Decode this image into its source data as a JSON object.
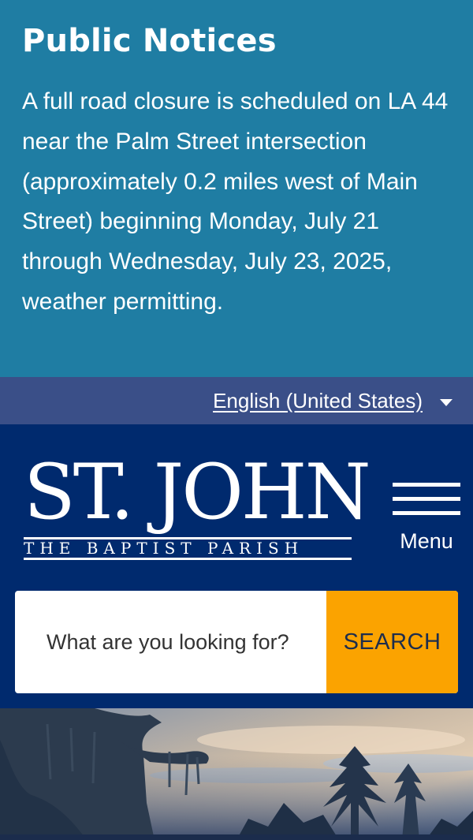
{
  "notice": {
    "heading": "Public Notices",
    "body": "A full road closure is scheduled on LA 44 near the Palm Street intersection (approximately 0.2 miles west of Main Street) beginning Monday, July 21 through Wednesday, July 23, 2025, weather permitting."
  },
  "language": {
    "selected": "English (United States)",
    "icon": "chevron-down-icon"
  },
  "header": {
    "logo_main": "ST. JOHN",
    "logo_sub": "THE BAPTIST PARISH",
    "menu_label": "Menu",
    "menu_icon": "hamburger-menu-icon"
  },
  "search": {
    "placeholder": "What are you looking for?",
    "button_label": "SEARCH"
  },
  "colors": {
    "notice_bg": "#1f7da3",
    "language_bar_bg": "#3a4f88",
    "header_bg": "#002a6e",
    "search_button": "#fba300"
  }
}
